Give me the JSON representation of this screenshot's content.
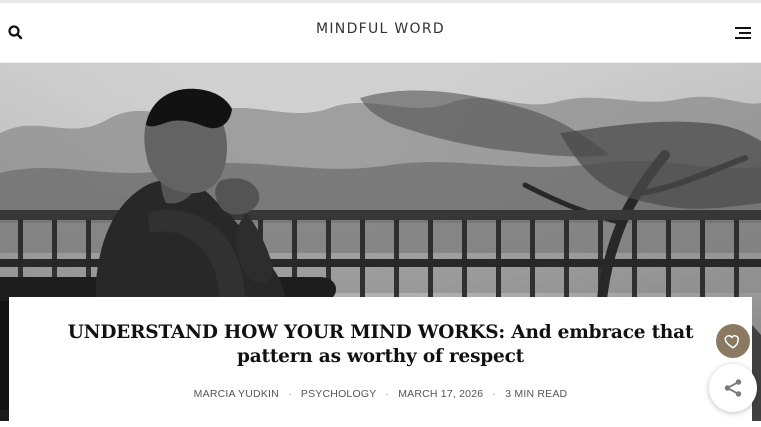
{
  "header": {
    "logo_text": "MINDFUL WORD",
    "search_icon": "search-icon",
    "menu_icon": "hamburger-menu-icon"
  },
  "hero": {
    "style": "black-and-white photo",
    "subject": "man sitting on bench by railing, trees and water behind"
  },
  "article": {
    "title": "UNDERSTAND HOW YOUR MIND WORKS: And embrace that pattern as worthy of respect",
    "author": "MARCIA YUDKIN",
    "category": "PSYCHOLOGY",
    "date": "MARCH 17, 2026",
    "read_time": "3 MIN READ"
  },
  "actions": {
    "like_icon": "heart-icon",
    "share_icon": "share-icon",
    "like_color": "#8a7a62"
  }
}
